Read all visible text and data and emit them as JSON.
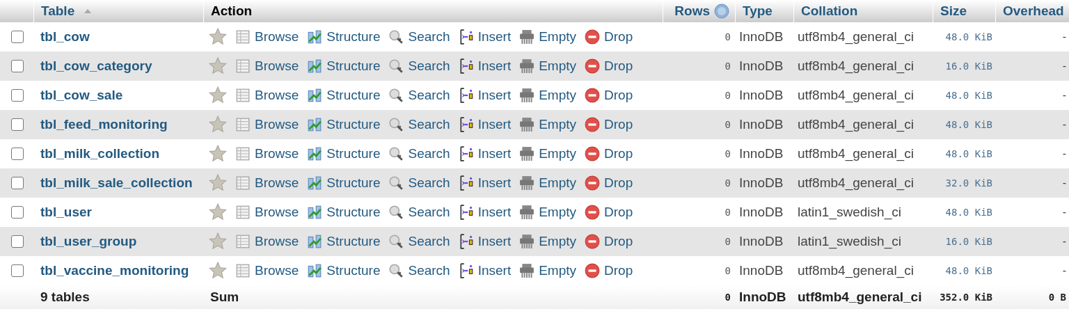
{
  "table": {
    "columns": [
      {
        "label": "Table",
        "sorted": true
      },
      {
        "label": "Action",
        "sorted": false
      },
      {
        "label": "Rows",
        "sorted": false,
        "help": true
      },
      {
        "label": "Type",
        "sorted": false
      },
      {
        "label": "Collation",
        "sorted": false
      },
      {
        "label": "Size",
        "sorted": false
      },
      {
        "label": "Overhead",
        "sorted": false
      }
    ],
    "rows": [
      {
        "checked": false,
        "name": "tbl_cow",
        "favorite": false,
        "actions": [
          {
            "kind": "browse",
            "label": "Browse"
          },
          {
            "kind": "structure",
            "label": "Structure"
          },
          {
            "kind": "search",
            "label": "Search"
          },
          {
            "kind": "insert",
            "label": "Insert"
          },
          {
            "kind": "empty",
            "label": "Empty"
          },
          {
            "kind": "drop",
            "label": "Drop"
          }
        ],
        "rows": "0",
        "type": "InnoDB",
        "collation": "utf8mb4_general_ci",
        "size": "48.0 KiB",
        "overhead": "-"
      },
      {
        "checked": false,
        "name": "tbl_cow_category",
        "favorite": false,
        "actions": [
          {
            "kind": "browse",
            "label": "Browse"
          },
          {
            "kind": "structure",
            "label": "Structure"
          },
          {
            "kind": "search",
            "label": "Search"
          },
          {
            "kind": "insert",
            "label": "Insert"
          },
          {
            "kind": "empty",
            "label": "Empty"
          },
          {
            "kind": "drop",
            "label": "Drop"
          }
        ],
        "rows": "0",
        "type": "InnoDB",
        "collation": "utf8mb4_general_ci",
        "size": "16.0 KiB",
        "overhead": "-"
      },
      {
        "checked": false,
        "name": "tbl_cow_sale",
        "favorite": false,
        "actions": [
          {
            "kind": "browse",
            "label": "Browse"
          },
          {
            "kind": "structure",
            "label": "Structure"
          },
          {
            "kind": "search",
            "label": "Search"
          },
          {
            "kind": "insert",
            "label": "Insert"
          },
          {
            "kind": "empty",
            "label": "Empty"
          },
          {
            "kind": "drop",
            "label": "Drop"
          }
        ],
        "rows": "0",
        "type": "InnoDB",
        "collation": "utf8mb4_general_ci",
        "size": "48.0 KiB",
        "overhead": "-"
      },
      {
        "checked": false,
        "name": "tbl_feed_monitoring",
        "favorite": false,
        "actions": [
          {
            "kind": "browse",
            "label": "Browse"
          },
          {
            "kind": "structure",
            "label": "Structure"
          },
          {
            "kind": "search",
            "label": "Search"
          },
          {
            "kind": "insert",
            "label": "Insert"
          },
          {
            "kind": "empty",
            "label": "Empty"
          },
          {
            "kind": "drop",
            "label": "Drop"
          }
        ],
        "rows": "0",
        "type": "InnoDB",
        "collation": "utf8mb4_general_ci",
        "size": "48.0 KiB",
        "overhead": "-"
      },
      {
        "checked": false,
        "name": "tbl_milk_collection",
        "favorite": false,
        "actions": [
          {
            "kind": "browse",
            "label": "Browse"
          },
          {
            "kind": "structure",
            "label": "Structure"
          },
          {
            "kind": "search",
            "label": "Search"
          },
          {
            "kind": "insert",
            "label": "Insert"
          },
          {
            "kind": "empty",
            "label": "Empty"
          },
          {
            "kind": "drop",
            "label": "Drop"
          }
        ],
        "rows": "0",
        "type": "InnoDB",
        "collation": "utf8mb4_general_ci",
        "size": "48.0 KiB",
        "overhead": "-"
      },
      {
        "checked": false,
        "name": "tbl_milk_sale_collection",
        "favorite": false,
        "actions": [
          {
            "kind": "browse",
            "label": "Browse"
          },
          {
            "kind": "structure",
            "label": "Structure"
          },
          {
            "kind": "search",
            "label": "Search"
          },
          {
            "kind": "insert",
            "label": "Insert"
          },
          {
            "kind": "empty",
            "label": "Empty"
          },
          {
            "kind": "drop",
            "label": "Drop"
          }
        ],
        "rows": "0",
        "type": "InnoDB",
        "collation": "utf8mb4_general_ci",
        "size": "32.0 KiB",
        "overhead": "-"
      },
      {
        "checked": false,
        "name": "tbl_user",
        "favorite": false,
        "actions": [
          {
            "kind": "browse",
            "label": "Browse"
          },
          {
            "kind": "structure",
            "label": "Structure"
          },
          {
            "kind": "search",
            "label": "Search"
          },
          {
            "kind": "insert",
            "label": "Insert"
          },
          {
            "kind": "empty",
            "label": "Empty"
          },
          {
            "kind": "drop",
            "label": "Drop"
          }
        ],
        "rows": "0",
        "type": "InnoDB",
        "collation": "latin1_swedish_ci",
        "size": "48.0 KiB",
        "overhead": "-"
      },
      {
        "checked": false,
        "name": "tbl_user_group",
        "favorite": false,
        "actions": [
          {
            "kind": "browse",
            "label": "Browse"
          },
          {
            "kind": "structure",
            "label": "Structure"
          },
          {
            "kind": "search",
            "label": "Search"
          },
          {
            "kind": "insert",
            "label": "Insert"
          },
          {
            "kind": "empty",
            "label": "Empty"
          },
          {
            "kind": "drop",
            "label": "Drop"
          }
        ],
        "rows": "0",
        "type": "InnoDB",
        "collation": "latin1_swedish_ci",
        "size": "16.0 KiB",
        "overhead": "-"
      },
      {
        "checked": false,
        "name": "tbl_vaccine_monitoring",
        "favorite": false,
        "actions": [
          {
            "kind": "browse",
            "label": "Browse"
          },
          {
            "kind": "structure",
            "label": "Structure"
          },
          {
            "kind": "search",
            "label": "Search"
          },
          {
            "kind": "insert",
            "label": "Insert"
          },
          {
            "kind": "empty",
            "label": "Empty"
          },
          {
            "kind": "drop",
            "label": "Drop"
          }
        ],
        "rows": "0",
        "type": "InnoDB",
        "collation": "utf8mb4_general_ci",
        "size": "48.0 KiB",
        "overhead": "-"
      }
    ],
    "footer": {
      "count": "9 tables",
      "action": "Sum",
      "rows": "0",
      "type": "InnoDB",
      "collation": "utf8mb4_general_ci",
      "size": "352.0 KiB",
      "overhead": "0 B"
    }
  }
}
